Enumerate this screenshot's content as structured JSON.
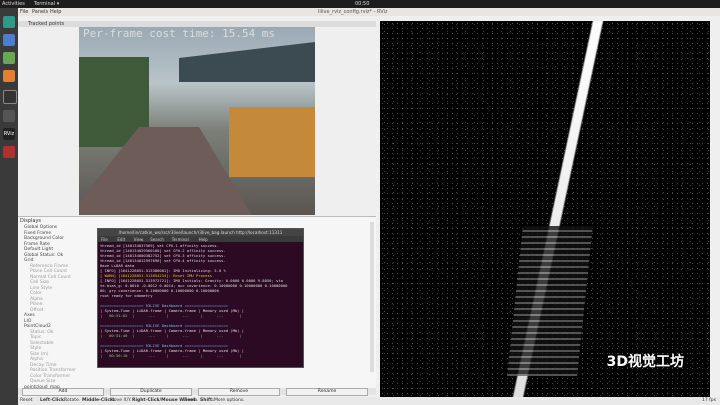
{
  "topbar": {
    "activities": "Activities",
    "app": "Terminal ▾",
    "clock": "00:50",
    "window_title": "lilive_rviz_config.rviz* - RViz"
  },
  "menubar": {
    "file": "File",
    "panels": "Panels",
    "help": "Help"
  },
  "image_panel": {
    "title": "Tracked points",
    "overlay_text": "Per-frame cost time: 15.54 ms"
  },
  "displays": {
    "title": "Displays",
    "rows": [
      {
        "label": "Global Options",
        "dim": false
      },
      {
        "label": "Fixed Frame",
        "dim": false
      },
      {
        "label": "Background Color",
        "dim": false
      },
      {
        "label": "Frame Rate",
        "dim": false
      },
      {
        "label": "Default Light",
        "dim": false
      },
      {
        "label": "Global Status: Ok",
        "dim": false
      },
      {
        "label": "Grid",
        "dim": false
      },
      {
        "label": "Reference Frame",
        "dim": true
      },
      {
        "label": "Plane Cell Count",
        "dim": true
      },
      {
        "label": "Normal Cell Count",
        "dim": true
      },
      {
        "label": "Cell Size",
        "dim": true
      },
      {
        "label": "Line Style",
        "dim": true
      },
      {
        "label": "Color",
        "dim": true
      },
      {
        "label": "Alpha",
        "dim": true
      },
      {
        "label": "Plane",
        "dim": true
      },
      {
        "label": "Offset",
        "dim": true
      },
      {
        "label": "Axes",
        "dim": false
      },
      {
        "label": "LIO",
        "dim": false
      },
      {
        "label": "PointCloud2",
        "dim": false
      },
      {
        "label": "Status: Ok",
        "dim": true
      },
      {
        "label": "Topic",
        "dim": true
      },
      {
        "label": "Selectable",
        "dim": true
      },
      {
        "label": "Style",
        "dim": true
      },
      {
        "label": "Size (m)",
        "dim": true
      },
      {
        "label": "Alpha",
        "dim": true
      },
      {
        "label": "Decay Time",
        "dim": true
      },
      {
        "label": "Position Transformer",
        "dim": true
      },
      {
        "label": "Color Transformer",
        "dim": true
      },
      {
        "label": "Queue Size",
        "dim": true
      },
      {
        "label": "pointcloud_map",
        "dim": false
      }
    ]
  },
  "buttons": {
    "add": "Add",
    "duplicate": "Duplicate",
    "remove": "Remove",
    "rename": "Rename"
  },
  "statusbar": {
    "reset": "Reset",
    "hint_left": "Left-Click:",
    "hint_left_val": "Rotate.",
    "hint_mid": "Middle-Click:",
    "hint_mid_val": "Move X/Y.",
    "hint_right": "Right-Click/Mouse Wheel:",
    "hint_right_val": "Zoom.",
    "hint_shift": "Shift:",
    "hint_shift_val": "More options.",
    "fps": "17 fps"
  },
  "terminal": {
    "title": "/home/lin/catkin_ws/src/r3live/launch/r3live_bag.launch http://localhost:11311",
    "menu": [
      "File",
      "Edit",
      "View",
      "Search",
      "Terminal",
      "Help"
    ],
    "lines": [
      {
        "text": "thread_id [140134037569} set CPU-1 affinity success.",
        "cls": ""
      },
      {
        "text": "thread_id [140134029560100] set CPU-2 affinity success.",
        "cls": ""
      },
      {
        "text": "thread_id [140134000382752] set CPU-3 affinity success.",
        "cls": ""
      },
      {
        "text": "thread_id [140134012597696] set CPU-4 affinity success.",
        "cls": ""
      },
      {
        "text": "Have LiDAR data",
        "cls": ""
      },
      {
        "text": "[ INFO] [1641228051.513380001]: IMU Initializing: 5.0 %",
        "cls": ""
      },
      {
        "text": "[ WARN] [1641228051.513654234]: Reset IMU Process",
        "cls": "y"
      },
      {
        "text": "[ INFO] [1641228051.513972721]: IMU Initials: Gravity: 0.0000 0.0000 9.8050; sta",
        "cls": ""
      },
      {
        "text": "te.bias_g: 0.0010 -0.0012 0.0014; acc covarience: 0.10000000 0.10000000 0.10000000",
        "cls": ""
      },
      {
        "text": "00; gry covarience: 0.10000000 0.10000000 0.10000000",
        "cls": ""
      },
      {
        "text": "root ready for odometry",
        "cls": ""
      },
      {
        "text": "",
        "cls": ""
      },
      {
        "text": "=================== R3LIVE Dashboard ===================",
        "cls": "c"
      },
      {
        "text": "| System-Time | LiDAR-frame | Camera-frame | Memory used (Mb) |",
        "cls": ""
      },
      {
        "text": "|   00:51:02  |      ---     |      ---     |      ---       |",
        "cls": "g"
      },
      {
        "text": "",
        "cls": ""
      },
      {
        "text": "=================== R3LIVE Dashboard ===================",
        "cls": "c"
      },
      {
        "text": "| System-Time | LiDAR-frame | Camera-frame | Memory used (Mb) |",
        "cls": ""
      },
      {
        "text": "|   00:51:40  |      ---     |      ---     |      ---       |",
        "cls": "g"
      },
      {
        "text": "",
        "cls": ""
      },
      {
        "text": "=================== R3LIVE Dashboard ===================",
        "cls": "c"
      },
      {
        "text": "| System-Time | LiDAR-frame | Camera-frame | Memory used (Mb) |",
        "cls": ""
      },
      {
        "text": "|   00:56:10  |      ---     |      ---     |      ---       |",
        "cls": "g"
      }
    ]
  },
  "watermark": "3D视觉工坊"
}
